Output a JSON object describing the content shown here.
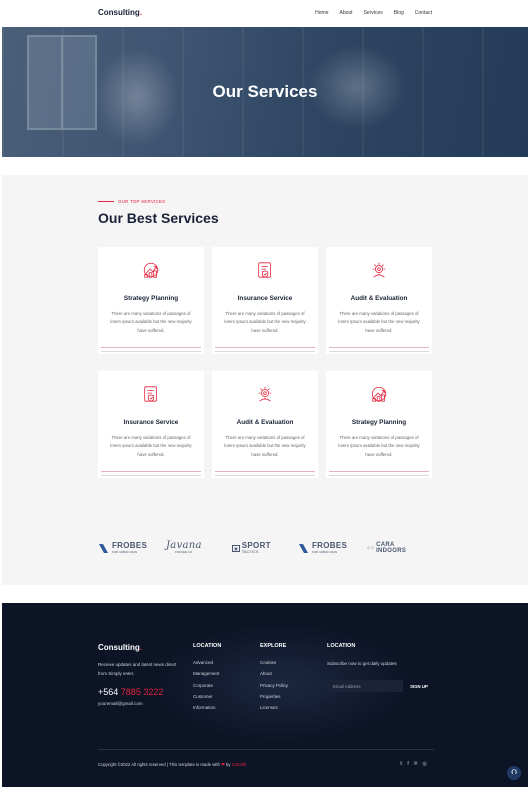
{
  "brand": {
    "name": "Consulting",
    "dot": "."
  },
  "nav": {
    "items": [
      "Home",
      "About",
      "Services",
      "Blog",
      "Contact"
    ]
  },
  "hero": {
    "title": "Our Services"
  },
  "services": {
    "eyebrow": "OUR TOP SERVICES",
    "title": "Our Best Services",
    "cards": [
      {
        "title": "Strategy Planning",
        "icon": "strategy-icon",
        "text": "There are many variations of passages of lorem Ipsum available but the new majority have suffered."
      },
      {
        "title": "Insurance Service",
        "icon": "insurance-icon",
        "text": "There are many variations of passages of lorem Ipsum available but the new majority have suffered."
      },
      {
        "title": "Audit & Evaluation",
        "icon": "audit-icon",
        "text": "There are many variations of passages of lorem Ipsum available but the new majority have suffered."
      },
      {
        "title": "Insurance Service",
        "icon": "insurance-icon",
        "text": "There are many variations of passages of lorem Ipsum available but the new majority have suffered."
      },
      {
        "title": "Audit & Evaluation",
        "icon": "audit-icon",
        "text": "There are many variations of passages of lorem Ipsum available but the new majority have suffered."
      },
      {
        "title": "Strategy Planning",
        "icon": "strategy-icon",
        "text": "There are many variations of passages of lorem Ipsum available but the new majority have suffered."
      }
    ]
  },
  "brands": [
    {
      "name": "FROBES",
      "sub": "FOR URBAN MAN"
    },
    {
      "name": "Javana",
      "sub": "COFFEE CO."
    },
    {
      "name": "SPORT",
      "sub": "TACTICS"
    },
    {
      "name": "FROBES",
      "sub": "FOR URBAN MAN"
    },
    {
      "name": "CARA INDOORS",
      "sub": ""
    }
  ],
  "footer": {
    "logo": "Consulting",
    "tagline": "Receive updates and latest news direct from Simply enter.",
    "phone_prefix": "+564",
    "phone_rest": "7885 3222",
    "email": "youremail@gmail.com",
    "col1": {
      "heading": "LOCATION",
      "items": [
        "Advanced",
        "Management",
        "Corporate",
        "Customer",
        "Information"
      ]
    },
    "col2": {
      "heading": "EXPLORE",
      "items": [
        "Cookies",
        "About",
        "Privacy Policy",
        "Properties",
        "Licenses"
      ]
    },
    "col3": {
      "heading": "LOCATION",
      "subscribe_text": "Subscribe now to get daily updates",
      "email_placeholder": "Email Address",
      "button": "SIGN UP"
    },
    "copyright_prefix": "Copyright ©2022 All rights reserved | This template is made with",
    "copyright_by": "by",
    "copyright_brand": "Colorlib",
    "social": [
      "twitter-icon",
      "facebook-icon",
      "pinterest-icon",
      "instagram-icon"
    ]
  },
  "colors": {
    "accent": "#e2233b",
    "navy": "#1a2238",
    "footer_bg": "#0d1426",
    "section_bg": "#f5f5f5"
  }
}
